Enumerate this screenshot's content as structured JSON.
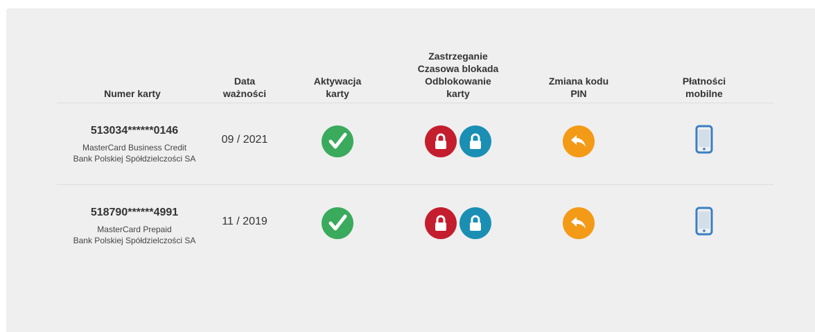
{
  "headers": {
    "number": "Numer karty",
    "expiry": "Data\nważności",
    "activation": "Aktywacja\nkarty",
    "blocking": "Zastrzeganie\nCzasowa blokada\nOdblokowanie\nkarty",
    "pin": "Zmiana kodu\nPIN",
    "mobile": "Płatności\nmobilne"
  },
  "cards": [
    {
      "number": "513034******0146",
      "type": "MasterCard Business Credit",
      "bank": "Bank Polskiej Spółdzielczości SA",
      "expiry": "09 / 2021"
    },
    {
      "number": "518790******4991",
      "type": "MasterCard Prepaid",
      "bank": "Bank Polskiej Spółdzielczości SA",
      "expiry": "11 / 2019"
    }
  ],
  "icons": {
    "activate": "check-icon",
    "block": "lock-icon",
    "temp_block": "lock-icon",
    "pin_change": "reply-arrow-icon",
    "mobile": "smartphone-icon"
  },
  "colors": {
    "panel_bg": "#efefef",
    "activate_green": "#3aaa5c",
    "block_red": "#c41e2e",
    "temp_block_teal": "#1a8fb3",
    "pin_orange": "#f39a16",
    "mobile_blue": "#3b7fc4"
  }
}
